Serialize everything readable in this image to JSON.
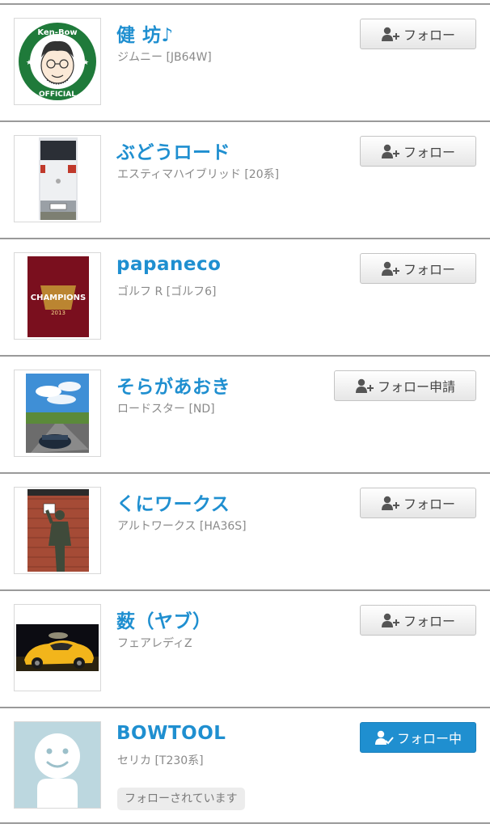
{
  "users": [
    {
      "name": "健 坊♪",
      "car": "ジムニー [JB64W]",
      "button": "フォロー",
      "badge": "",
      "avatar": {
        "kind": "logo",
        "text_top": "Ken-Bow",
        "text_bottom": "OFFICIAL"
      }
    },
    {
      "name": "ぶどうロード",
      "car": "エスティマハイブリッド [20系]",
      "button": "フォロー",
      "badge": "",
      "avatar": {
        "kind": "white-car-rear"
      }
    },
    {
      "name": "papaneco",
      "car": "ゴルフ R [ゴルフ6]",
      "button": "フォロー",
      "badge": "",
      "avatar": {
        "kind": "champions-flag",
        "text": "CHAMPIONS",
        "year": "2013"
      }
    },
    {
      "name": "そらがあおき",
      "car": "ロードスター [ND]",
      "button": "フォロー申請",
      "badge": "",
      "avatar": {
        "kind": "sky-road-car"
      }
    },
    {
      "name": "くにワークス",
      "car": "アルトワークス [HA36S]",
      "button": "フォロー",
      "badge": "",
      "avatar": {
        "kind": "statue-brick-wall"
      }
    },
    {
      "name": "薮（ヤブ）",
      "car": "フェアレディZ",
      "button": "フォロー",
      "badge": "",
      "avatar": {
        "kind": "yellow-car-night"
      }
    },
    {
      "name": "BOWTOOL",
      "car": "セリカ [T230系]",
      "button": "フォロー中",
      "badge": "フォローされています",
      "avatar": {
        "kind": "default-avatar"
      }
    }
  ],
  "colors": {
    "accent": "#1f8fd0",
    "divider": "#9a9a9a",
    "subtext": "#8a8a8a"
  },
  "icons": {
    "follow": "person-plus-icon",
    "following": "person-check-icon"
  }
}
